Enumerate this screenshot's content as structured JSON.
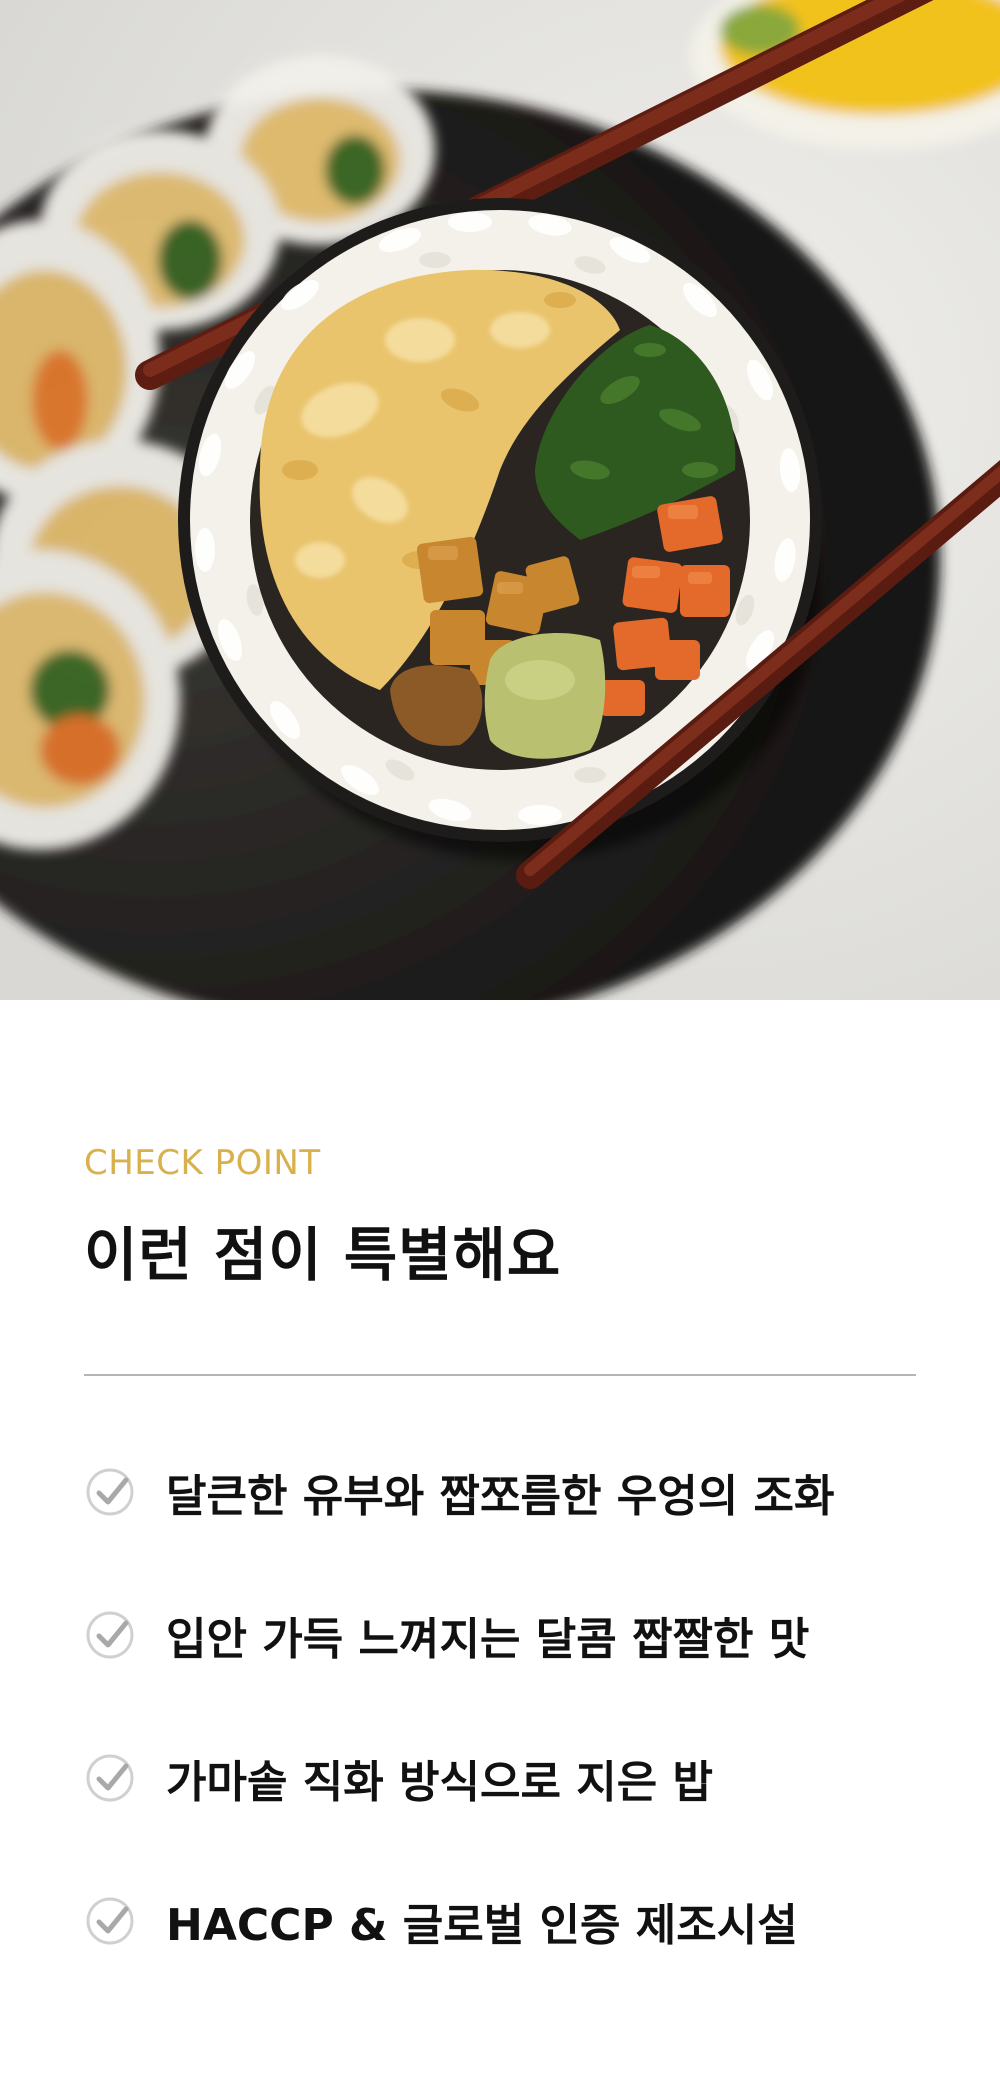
{
  "hero": {
    "image": "gimbap-roll-held-by-chopsticks",
    "colors": {
      "background": "#e6e6e4",
      "seaweed": "#1f1d1c",
      "rice": "#f4f2ec",
      "egg": "#e8c16a",
      "spinach": "#2f5a20",
      "carrot": "#e06a2a",
      "burdock": "#c8842c",
      "chopsticks": "#7a2818"
    }
  },
  "section": {
    "eyebrow": "CHECK POINT",
    "title": "이런 점이 특별해요",
    "accent_color": "#d8b14c"
  },
  "checklist": {
    "items": [
      {
        "icon": "check-circle-icon",
        "text": "달큰한 유부와 짭쪼름한 우엉의 조화"
      },
      {
        "icon": "check-circle-icon",
        "text": "입안 가득 느껴지는 달콤 짭짤한 맛"
      },
      {
        "icon": "check-circle-icon",
        "text": "가마솥 직화 방식으로 지은 밥"
      },
      {
        "icon": "check-circle-icon",
        "text": "HACCP & 글로벌 인증 제조시설"
      }
    ]
  }
}
